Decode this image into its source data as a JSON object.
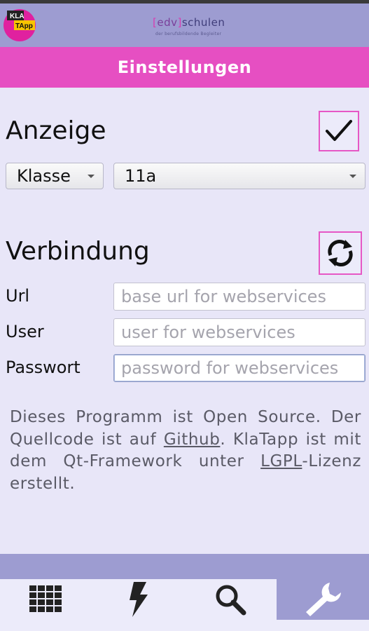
{
  "app": {
    "logo_text_top": "KLA",
    "logo_text_bottom": "TApp",
    "brand_open": "[",
    "brand_edv": "edv",
    "brand_close": "]",
    "brand_schulen": "schulen",
    "brand_tagline": "der berufsbildende Begleiter",
    "colors": {
      "accent_pink": "#e64fc2",
      "header_purple": "#9d9cd1",
      "background": "#e8e6f8"
    }
  },
  "page": {
    "title": "Einstellungen"
  },
  "anzeige": {
    "heading": "Anzeige",
    "confirm_icon": "check-icon",
    "klasse_label": "Klasse",
    "klasse_value": "11a"
  },
  "verbindung": {
    "heading": "Verbindung",
    "sync_icon": "refresh-icon",
    "url_label": "Url",
    "url_placeholder": "base url for webservices",
    "user_label": "User",
    "user_placeholder": "user for webservices",
    "passwort_label": "Passwort",
    "passwort_placeholder": "password for webservices"
  },
  "info": {
    "part1": "Dieses Programm ist Open Source. Der Quellcode ist auf ",
    "github_link": "Github",
    "part2": ". KlaTapp ist mit dem Qt-Framework unter ",
    "lgpl_link": "LGPL",
    "part3": "-Lizenz erstellt."
  },
  "tabs": [
    {
      "icon": "grid-icon",
      "active": false
    },
    {
      "icon": "lightning-icon",
      "active": false
    },
    {
      "icon": "search-icon",
      "active": false
    },
    {
      "icon": "wrench-icon",
      "active": true
    }
  ]
}
